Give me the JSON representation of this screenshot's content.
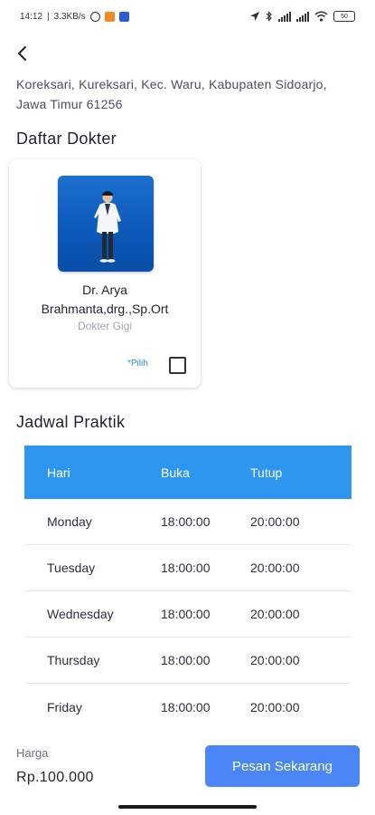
{
  "status_bar": {
    "time": "14:12",
    "speed": "3.3KB/s",
    "battery": "50"
  },
  "address": "Koreksari, Kureksari, Kec. Waru, Kabupaten Sidoarjo, Jawa Timur 61256",
  "doctors_section": {
    "title": "Daftar Dokter",
    "doctors": [
      {
        "name": "Dr. Arya Brahmanta,drg.,Sp.Ort",
        "specialty": "Dokter Gigi",
        "pick_label": "*Pilih"
      }
    ]
  },
  "schedule_section": {
    "title": "Jadwal Praktik",
    "headers": [
      "Hari",
      "Buka",
      "Tutup"
    ],
    "rows": [
      [
        "Monday",
        "18:00:00",
        "20:00:00"
      ],
      [
        "Tuesday",
        "18:00:00",
        "20:00:00"
      ],
      [
        "Wednesday",
        "18:00:00",
        "20:00:00"
      ],
      [
        "Thursday",
        "18:00:00",
        "20:00:00"
      ],
      [
        "Friday",
        "18:00:00",
        "20:00:00"
      ]
    ]
  },
  "footer": {
    "price_label": "Harga",
    "price_value": "Rp.100.000",
    "order_button": "Pesan Sekarang"
  },
  "colors": {
    "table_header": "#2d96ef",
    "order_button": "#4a86f5",
    "pick_label": "#2e8de6"
  }
}
